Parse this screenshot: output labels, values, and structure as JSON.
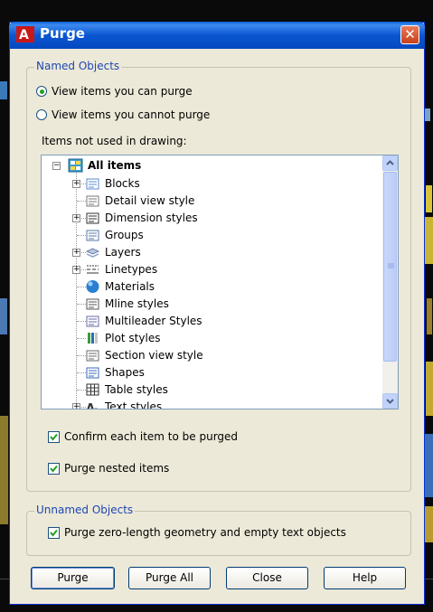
{
  "window": {
    "title": "Purge",
    "close_glyph": "✕"
  },
  "named_objects": {
    "legend": "Named Objects",
    "radio_purge": {
      "label": "View items you can purge",
      "selected": true
    },
    "radio_cannot": {
      "label": "View items you cannot purge",
      "selected": false
    },
    "tree_label": "Items not used in drawing:",
    "tree": {
      "root": "All items",
      "items": [
        {
          "label": "Blocks",
          "expandable": true,
          "icon": "blocks-icon"
        },
        {
          "label": "Detail view style",
          "expandable": false,
          "icon": "detail-view-icon"
        },
        {
          "label": "Dimension styles",
          "expandable": true,
          "icon": "dimension-icon"
        },
        {
          "label": "Groups",
          "expandable": false,
          "icon": "groups-icon"
        },
        {
          "label": "Layers",
          "expandable": true,
          "icon": "layers-icon"
        },
        {
          "label": "Linetypes",
          "expandable": true,
          "icon": "linetypes-icon"
        },
        {
          "label": "Materials",
          "expandable": false,
          "icon": "materials-icon"
        },
        {
          "label": "Mline styles",
          "expandable": false,
          "icon": "mline-icon"
        },
        {
          "label": "Multileader Styles",
          "expandable": false,
          "icon": "multileader-icon"
        },
        {
          "label": "Plot styles",
          "expandable": false,
          "icon": "plot-styles-icon"
        },
        {
          "label": "Section view style",
          "expandable": false,
          "icon": "section-view-icon"
        },
        {
          "label": "Shapes",
          "expandable": false,
          "icon": "shapes-icon"
        },
        {
          "label": "Table styles",
          "expandable": false,
          "icon": "table-styles-icon"
        },
        {
          "label": "Text styles",
          "expandable": true,
          "icon": "text-styles-icon"
        }
      ]
    },
    "confirm": {
      "label": "Confirm each item to be purged",
      "checked": true
    },
    "nested": {
      "label": "Purge nested items",
      "checked": true
    }
  },
  "unnamed_objects": {
    "legend": "Unnamed Objects",
    "zero_length": {
      "label": "Purge zero-length geometry and empty text objects",
      "checked": true
    }
  },
  "buttons": {
    "purge": "Purge",
    "purge_all": "Purge All",
    "close": "Close",
    "help": "Help"
  },
  "colors": {
    "accent": "#1e46b4",
    "titlebar": "#0a56d0",
    "check": "#21a121"
  }
}
